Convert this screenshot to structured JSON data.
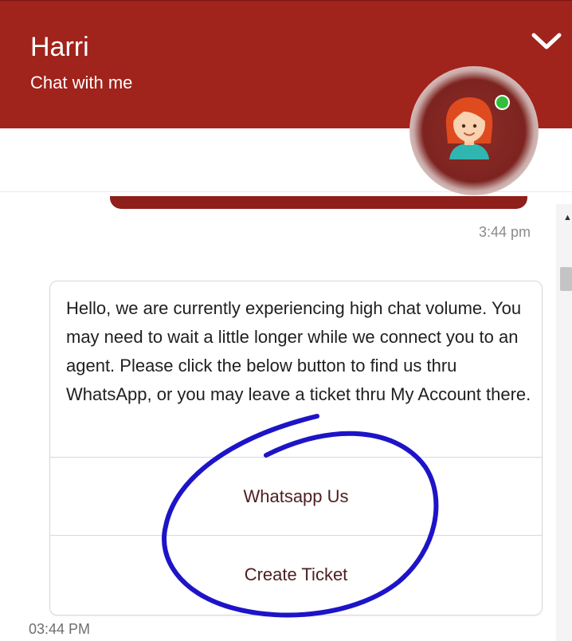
{
  "header": {
    "agent_name": "Harri",
    "subtitle": "Chat with me"
  },
  "chat": {
    "first_timestamp": "3:44 pm",
    "message": {
      "text": "Hello, we are currently experiencing high chat volume. You may need to wait a little longer while we connect you to an agent. Please click the below button to find us thru WhatsApp, or you may leave a ticket thru My Account there.",
      "buttons": [
        "Whatsapp Us",
        "Create Ticket"
      ]
    },
    "message_timestamp": "03:44 PM"
  },
  "colors": {
    "header_bg": "#a0231c",
    "presence_online": "#2fbf3a",
    "annotation_ink": "#1d14c8"
  },
  "icons": {
    "collapse": "chevron-down-icon",
    "avatar": "agent-avatar",
    "presence": "online-status-dot"
  }
}
